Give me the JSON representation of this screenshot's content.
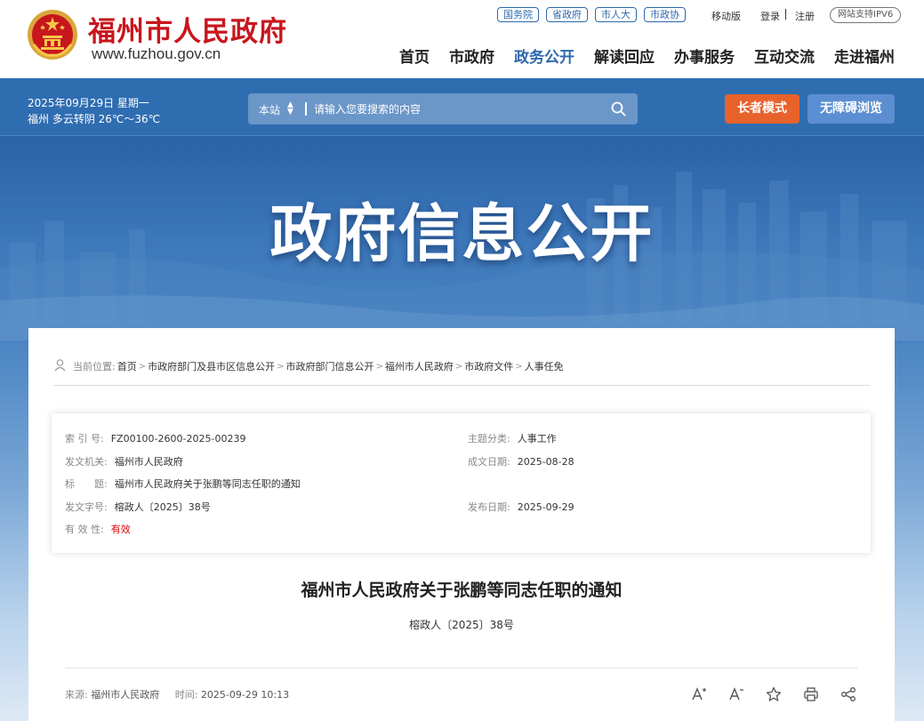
{
  "header": {
    "site_name": "福州市人民政府",
    "site_url": "www.fuzhou.gov.cn",
    "top_links": [
      "国务院",
      "省政府",
      "市人大",
      "市政协"
    ],
    "mobile": "移动版",
    "login": "登录",
    "register": "注册",
    "ipv6": "网站支持IPV6",
    "nav": [
      "首页",
      "市政府",
      "政务公开",
      "解读回应",
      "办事服务",
      "互动交流",
      "走进福州"
    ],
    "active_nav": "政务公开"
  },
  "topbar": {
    "date": "2025年09月29日 星期一",
    "weather": "福州 多云转阴 26℃～36℃",
    "search_scope": "本站",
    "search_placeholder": "请输入您要搜索的内容",
    "elder_mode": "长者模式",
    "accessible": "无障碍浏览"
  },
  "banner": {
    "title": "政府信息公开"
  },
  "breadcrumb": {
    "label": "当前位置:",
    "items": [
      "首页",
      "市政府部门及县市区信息公开",
      "市政府部门信息公开",
      "福州市人民政府",
      "市政府文件",
      "人事任免"
    ]
  },
  "meta": {
    "index_label": "索 引 号:",
    "index_value": "FZ00100-2600-2025-00239",
    "topic_label": "主题分类:",
    "topic_value": "人事工作",
    "issuer_label": "发文机关:",
    "issuer_value": "福州市人民政府",
    "created_label": "成文日期:",
    "created_value": "2025-08-28",
    "title_label": "标　　题:",
    "title_value": "福州市人民政府关于张鹏等同志任职的通知",
    "docno_label": "发文字号:",
    "docno_value": "榕政人〔2025〕38号",
    "published_label": "发布日期:",
    "published_value": "2025-09-29",
    "validity_label": "有 效 性:",
    "validity_value": "有效"
  },
  "document": {
    "title": "福州市人民政府关于张鹏等同志任职的通知",
    "number": "榕政人〔2025〕38号",
    "source_label": "来源:",
    "source_value": "福州市人民政府",
    "time_label": "时间:",
    "time_value": "2025-09-29 10:13"
  },
  "colors": {
    "brand_red": "#c8161d",
    "brand_blue": "#2d68ad",
    "elder_orange": "#e8622c",
    "valid_red": "#dd0000"
  },
  "icons": [
    "national-emblem-icon",
    "search-icon",
    "location-person-icon",
    "font-increase-icon",
    "font-decrease-icon",
    "star-icon",
    "print-icon",
    "share-icon"
  ]
}
